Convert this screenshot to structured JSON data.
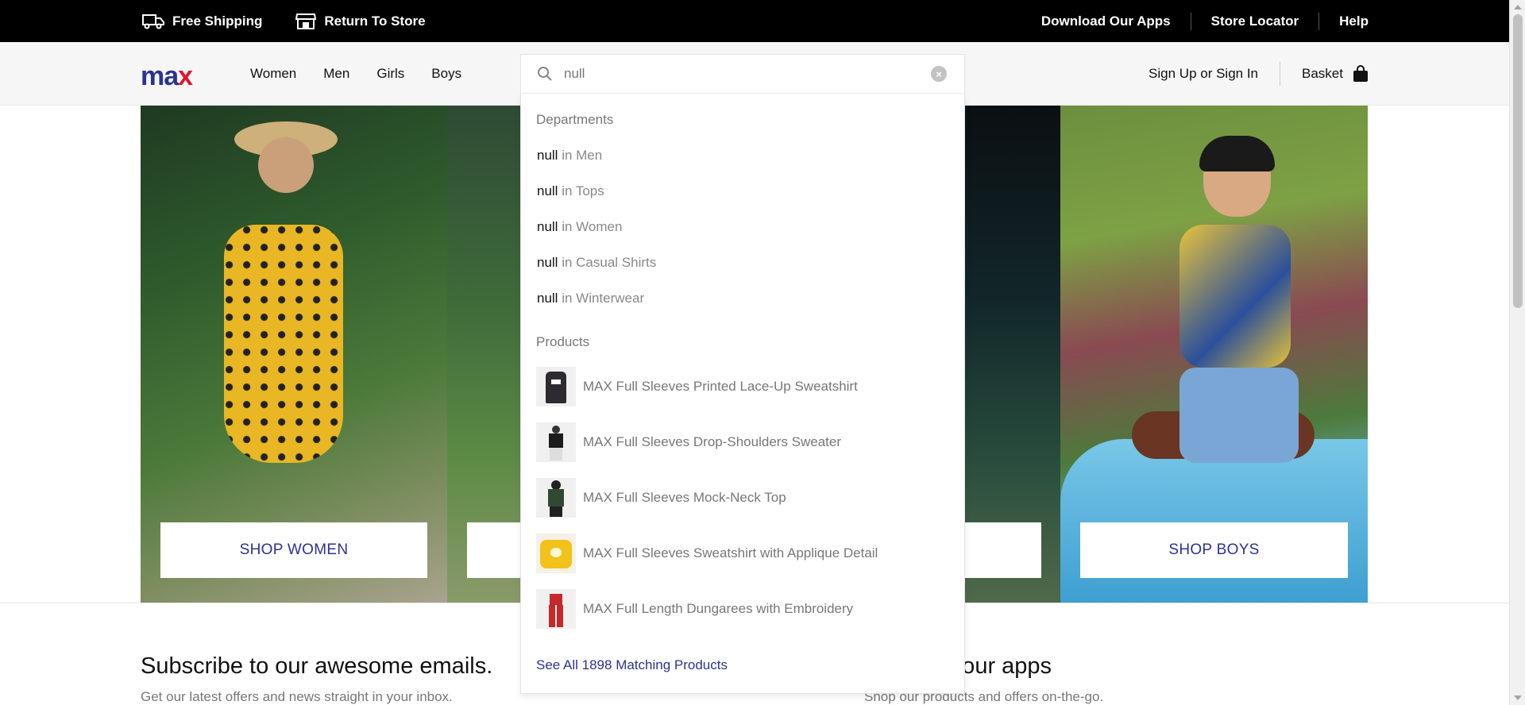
{
  "topbar": {
    "free_shipping": "Free Shipping",
    "return_to_store": "Return To Store",
    "links": [
      "Download Our Apps",
      "Store Locator",
      "Help"
    ]
  },
  "header": {
    "logo_m": "m",
    "logo_a": "a",
    "logo_x": "x",
    "nav": [
      "Women",
      "Men",
      "Girls",
      "Boys"
    ],
    "sign_in": "Sign Up or Sign In",
    "basket": "Basket"
  },
  "search": {
    "value": "null",
    "clear_glyph": "×"
  },
  "dropdown": {
    "departments_heading": "Departments",
    "departments": [
      {
        "term": "null",
        "rest": " in Men"
      },
      {
        "term": "null",
        "rest": " in Tops"
      },
      {
        "term": "null",
        "rest": " in Women"
      },
      {
        "term": "null",
        "rest": " in Casual Shirts"
      },
      {
        "term": "null",
        "rest": " in Winterwear"
      }
    ],
    "products_heading": "Products",
    "products": [
      {
        "name": "MAX Full Sleeves Printed Lace-Up Sweatshirt",
        "color": "#2d2b31"
      },
      {
        "name": "MAX Full Sleeves Drop-Shoulders Sweater",
        "color": "#1c1c1c"
      },
      {
        "name": "MAX Full Sleeves Mock-Neck Top",
        "color": "#2f4a34"
      },
      {
        "name": "MAX Full Sleeves Sweatshirt with Applique Detail",
        "color": "#f2c21b"
      },
      {
        "name": "MAX Full Length Dungarees with Embroidery",
        "color": "#c6282b"
      }
    ],
    "see_all": "See All 1898 Matching Products"
  },
  "hero": {
    "shop_women": "SHOP WOMEN",
    "shop_men": "",
    "shop_girls": "",
    "shop_boys": "SHOP BOYS"
  },
  "footer": {
    "subscribe_title": "Subscribe to our awesome emails.",
    "subscribe_sub": "Get our latest offers and news straight in your inbox.",
    "apps_title": "d our apps",
    "apps_sub": "Shop our products and offers on-the-go."
  },
  "colors": {
    "brand_blue": "#2b3391",
    "brand_red": "#e0142c"
  }
}
